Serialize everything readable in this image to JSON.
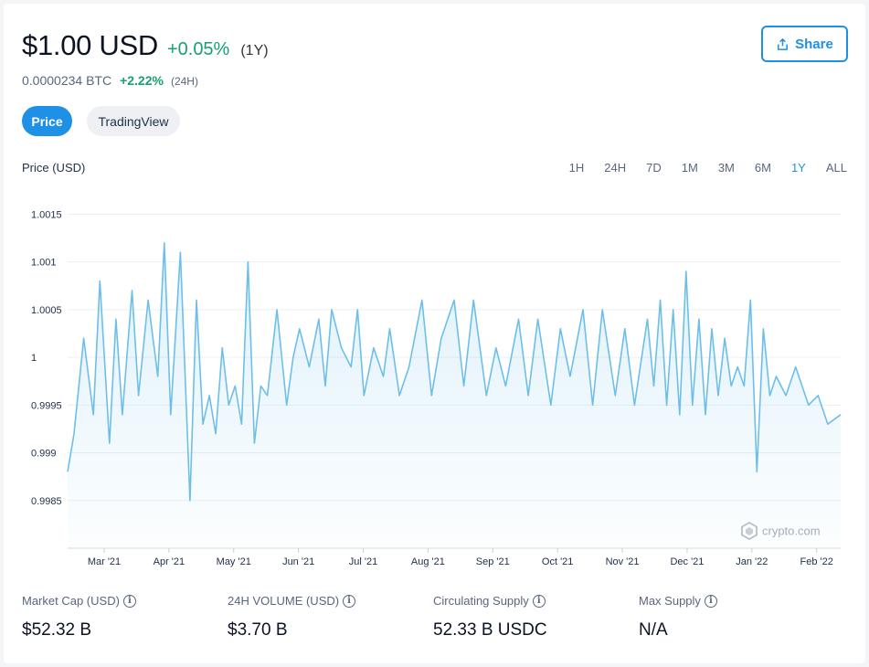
{
  "header": {
    "price": "$1.00 USD",
    "change": "+0.05%",
    "period": "(1Y)",
    "btc_price": "0.0000234 BTC",
    "btc_change": "+2.22%",
    "btc_period": "(24H)",
    "share_label": "Share"
  },
  "tabs": [
    {
      "label": "Price",
      "active": true
    },
    {
      "label": "TradingView",
      "active": false
    }
  ],
  "chart_label": "Price (USD)",
  "ranges": [
    "1H",
    "24H",
    "7D",
    "1M",
    "3M",
    "6M",
    "1Y",
    "ALL"
  ],
  "active_range": "1Y",
  "watermark": "crypto.com",
  "colors": {
    "accent": "#1e90e6",
    "positive": "#16a16e",
    "line": "#6dbfea"
  },
  "chart_data": {
    "type": "area",
    "title": "",
    "xlabel": "",
    "ylabel": "Price (USD)",
    "ylim": [
      0.998,
      1.0016
    ],
    "yticks": [
      1.0015,
      1.001,
      1.0005,
      1,
      0.9995,
      0.999,
      0.9985
    ],
    "ytick_labels": [
      "1.0015",
      "1.001",
      "1.0005",
      "1",
      "0.9995",
      "0.999",
      "0.9985"
    ],
    "xtick_labels": [
      "Mar '21",
      "Apr '21",
      "May '21",
      "Jun '21",
      "Jul '21",
      "Aug '21",
      "Sep '21",
      "Oct '21",
      "Nov '21",
      "Dec '21",
      "Jan '22",
      "Feb '22"
    ],
    "xlim": [
      0,
      24
    ],
    "grid": true,
    "series": [
      {
        "x": [
          0,
          0.2,
          0.5,
          0.8,
          1.0,
          1.3,
          1.5,
          1.7,
          2.0,
          2.2,
          2.5,
          2.8,
          3.0,
          3.2,
          3.5,
          3.8,
          4.0,
          4.2,
          4.4,
          4.6,
          4.8,
          5.0,
          5.2,
          5.4,
          5.6,
          5.8,
          6.0,
          6.2,
          6.5,
          6.8,
          7.0,
          7.2,
          7.5,
          7.8,
          8.0,
          8.2,
          8.5,
          8.8,
          9.0,
          9.2,
          9.5,
          9.8,
          10.0,
          10.3,
          10.6,
          11.0,
          11.3,
          11.6,
          12.0,
          12.3,
          12.6,
          13.0,
          13.3,
          13.6,
          14.0,
          14.3,
          14.6,
          15.0,
          15.3,
          15.6,
          16.0,
          16.3,
          16.6,
          17.0,
          17.3,
          17.6,
          18.0,
          18.2,
          18.4,
          18.6,
          18.8,
          19.0,
          19.2,
          19.4,
          19.6,
          19.8,
          20.0,
          20.2,
          20.4,
          20.6,
          20.8,
          21.0,
          21.2,
          21.4,
          21.6,
          21.8,
          22.0,
          22.3,
          22.6,
          23.0,
          23.3,
          23.6,
          24.0
        ],
        "y": [
          0.9988,
          0.9992,
          1.0002,
          0.9994,
          1.0008,
          0.9991,
          1.0004,
          0.9994,
          1.0007,
          0.9996,
          1.0006,
          0.9998,
          1.0012,
          0.9994,
          1.0011,
          0.9985,
          1.0006,
          0.9993,
          0.9996,
          0.9992,
          1.0001,
          0.9995,
          0.9997,
          0.9993,
          1.001,
          0.9991,
          0.9997,
          0.9996,
          1.0005,
          0.9995,
          1.0,
          1.0003,
          0.9999,
          1.0004,
          0.9997,
          1.0005,
          1.0001,
          0.9999,
          1.0005,
          0.9996,
          1.0001,
          0.9998,
          1.0003,
          0.9996,
          0.9999,
          1.0006,
          0.9996,
          1.0002,
          1.0006,
          0.9997,
          1.0006,
          0.9996,
          1.0001,
          0.9997,
          1.0004,
          0.9996,
          1.0004,
          0.9995,
          1.0003,
          0.9998,
          1.0005,
          0.9995,
          1.0005,
          0.9996,
          1.0003,
          0.9995,
          1.0004,
          0.9997,
          1.0006,
          0.9995,
          1.0005,
          0.9994,
          1.0009,
          0.9995,
          1.0004,
          0.9994,
          1.0003,
          0.9996,
          1.0002,
          0.9997,
          0.9999,
          0.9997,
          1.0006,
          0.9988,
          1.0003,
          0.9996,
          0.9998,
          0.9996,
          0.9999,
          0.9995,
          0.9996,
          0.9993,
          0.9994
        ]
      }
    ]
  },
  "stats": [
    {
      "label": "Market Cap (USD)",
      "value": "$52.32 B"
    },
    {
      "label": "24H VOLUME (USD)",
      "value": "$3.70 B"
    },
    {
      "label": "Circulating Supply",
      "value": "52.33 B USDC"
    },
    {
      "label": "Max Supply",
      "value": "N/A"
    }
  ]
}
